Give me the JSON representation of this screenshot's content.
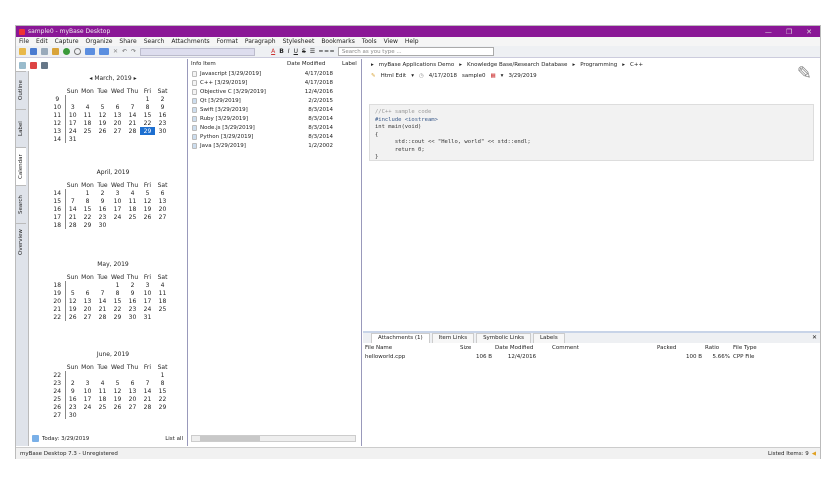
{
  "window": {
    "title": "sample0 - myBase Desktop",
    "controls": [
      "—",
      "❐",
      "✕"
    ]
  },
  "menu": [
    "File",
    "Edit",
    "Capture",
    "Organize",
    "Share",
    "Search",
    "Attachments",
    "Format",
    "Paragraph",
    "Stylesheet",
    "Bookmarks",
    "Tools",
    "View",
    "Help"
  ],
  "search": {
    "placeholder": "Search as you type ..."
  },
  "sidebar_tabs": [
    "Outline",
    "Label",
    "Calendar",
    "Search",
    "Overview"
  ],
  "calendars": [
    {
      "title": "March, 2019",
      "weeks": [
        [
          "9",
          "",
          "",
          "",
          "",
          "",
          "1",
          "2"
        ],
        [
          "10",
          "3",
          "4",
          "5",
          "6",
          "7",
          "8",
          "9"
        ],
        [
          "11",
          "10",
          "11",
          "12",
          "13",
          "14",
          "15",
          "16"
        ],
        [
          "12",
          "17",
          "18",
          "19",
          "20",
          "21",
          "22",
          "23"
        ],
        [
          "13",
          "24",
          "25",
          "26",
          "27",
          "28",
          "29",
          "30"
        ],
        [
          "14",
          "31",
          "",
          "",
          "",
          "",
          "",
          ""
        ]
      ],
      "selected": "29"
    },
    {
      "title": "April, 2019",
      "weeks": [
        [
          "14",
          "",
          "1",
          "2",
          "3",
          "4",
          "5",
          "6"
        ],
        [
          "15",
          "7",
          "8",
          "9",
          "10",
          "11",
          "12",
          "13"
        ],
        [
          "16",
          "14",
          "15",
          "16",
          "17",
          "18",
          "19",
          "20"
        ],
        [
          "17",
          "21",
          "22",
          "23",
          "24",
          "25",
          "26",
          "27"
        ],
        [
          "18",
          "28",
          "29",
          "30",
          "",
          "",
          "",
          ""
        ]
      ]
    },
    {
      "title": "May, 2019",
      "weeks": [
        [
          "18",
          "",
          "",
          "",
          "1",
          "2",
          "3",
          "4"
        ],
        [
          "19",
          "5",
          "6",
          "7",
          "8",
          "9",
          "10",
          "11"
        ],
        [
          "20",
          "12",
          "13",
          "14",
          "15",
          "16",
          "17",
          "18"
        ],
        [
          "21",
          "19",
          "20",
          "21",
          "22",
          "23",
          "24",
          "25"
        ],
        [
          "22",
          "26",
          "27",
          "28",
          "29",
          "30",
          "31",
          ""
        ]
      ]
    },
    {
      "title": "June, 2019",
      "weeks": [
        [
          "22",
          "",
          "",
          "",
          "",
          "",
          "",
          "1"
        ],
        [
          "23",
          "2",
          "3",
          "4",
          "5",
          "6",
          "7",
          "8"
        ],
        [
          "24",
          "9",
          "10",
          "11",
          "12",
          "13",
          "14",
          "15"
        ],
        [
          "25",
          "16",
          "17",
          "18",
          "19",
          "20",
          "21",
          "22"
        ],
        [
          "26",
          "23",
          "24",
          "25",
          "26",
          "27",
          "28",
          "29"
        ],
        [
          "27",
          "30",
          "",
          "",
          "",
          "",
          "",
          ""
        ]
      ]
    }
  ],
  "weekdays": [
    "Sun",
    "Mon",
    "Tue",
    "Wed",
    "Thu",
    "Fri",
    "Sat"
  ],
  "calendar_footer": {
    "today": "Today: 3/29/2019",
    "list_all": "List all"
  },
  "list": {
    "headers": [
      "Info Item",
      "Date Modified",
      "Label"
    ],
    "items": [
      [
        "Javascript [3/29/2019]",
        "4/17/2018"
      ],
      [
        "C++ [3/29/2019]",
        "4/17/2018"
      ],
      [
        "Objective C [3/29/2019]",
        "12/4/2016"
      ],
      [
        "Qt [3/29/2019]",
        "2/2/2015"
      ],
      [
        "Swift [3/29/2019]",
        "8/3/2014"
      ],
      [
        "Ruby [3/29/2019]",
        "8/3/2014"
      ],
      [
        "Node.js [3/29/2019]",
        "8/3/2014"
      ],
      [
        "Python [3/29/2019]",
        "8/3/2014"
      ],
      [
        "Java [3/29/2019]",
        "1/2/2002"
      ]
    ]
  },
  "breadcrumb": [
    "myBase Applications Demo",
    "Knowledge Base/Research Database",
    "Programming",
    "C++"
  ],
  "editor_bar": {
    "mode": "Html Edit",
    "modified": "4/17/2018",
    "db": "sample0",
    "date": "3/29/2019"
  },
  "code": [
    "//C++ sample code",
    "#include <iostream>",
    "int main(void)",
    "{",
    "      std::cout << \"Hello, world\" << std::endl;",
    "      return 0;",
    "}"
  ],
  "att_tabs": [
    "Attachments (1)",
    "Item Links",
    "Symbolic Links",
    "Labels"
  ],
  "att": {
    "headers": [
      "File Name",
      "Size",
      "Date Modified",
      "Comment",
      "Packed",
      "Ratio",
      "File Type"
    ],
    "rows": [
      [
        "helloworld.cpp",
        "106 B",
        "12/4/2016",
        "",
        "100 B",
        "5.66%",
        "CPP File"
      ]
    ]
  },
  "status": {
    "left": "myBase Desktop 7.3 - Unregistered",
    "right": "Listed Items: 9"
  },
  "colors": {
    "title": "#8a1796",
    "selected": "#1d6fd0"
  }
}
